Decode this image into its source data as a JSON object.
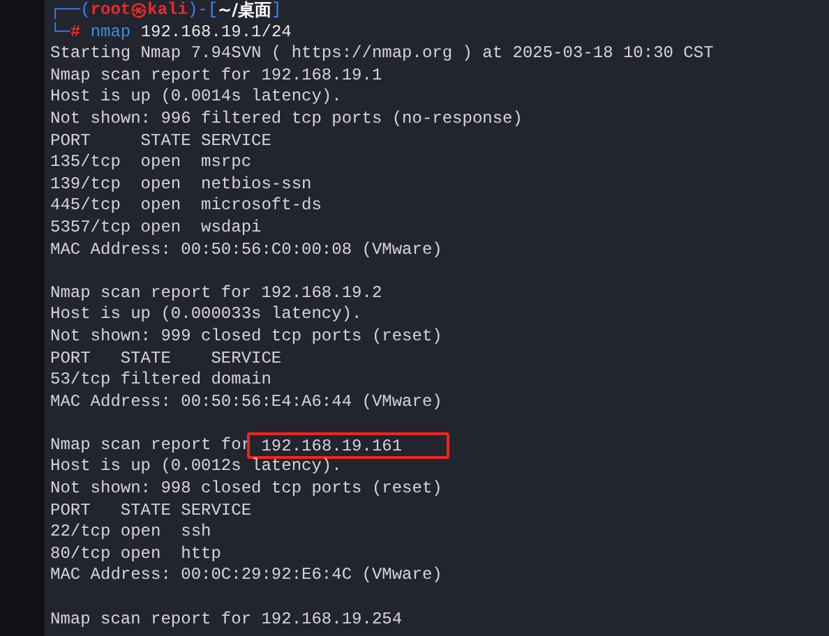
{
  "prompt": {
    "corner_top": "┌──(",
    "user": "root",
    "at": "㉿",
    "host": "kali",
    "mid": ")-[",
    "path": "~/桌面",
    "close": "]",
    "corner_bottom": "└─",
    "marker": "#",
    "command": "nmap",
    "args": "192.168.19.1/24"
  },
  "lines": [
    {
      "kind": "text",
      "text": "Starting Nmap 7.94SVN ( https://nmap.org ) at 2025-03-18 10:30 CST"
    },
    {
      "kind": "text",
      "text": "Nmap scan report for 192.168.19.1"
    },
    {
      "kind": "text",
      "text": "Host is up (0.0014s latency)."
    },
    {
      "kind": "text",
      "text": "Not shown: 996 filtered tcp ports (no-response)"
    },
    {
      "kind": "text",
      "text": "PORT     STATE SERVICE"
    },
    {
      "kind": "text",
      "text": "135/tcp  open  msrpc"
    },
    {
      "kind": "text",
      "text": "139/tcp  open  netbios-ssn"
    },
    {
      "kind": "text",
      "text": "445/tcp  open  microsoft-ds"
    },
    {
      "kind": "text",
      "text": "5357/tcp open  wsdapi"
    },
    {
      "kind": "text",
      "text": "MAC Address: 00:50:56:C0:00:08 (VMware)"
    },
    {
      "kind": "blank"
    },
    {
      "kind": "text",
      "text": "Nmap scan report for 192.168.19.2"
    },
    {
      "kind": "text",
      "text": "Host is up (0.000033s latency)."
    },
    {
      "kind": "text",
      "text": "Not shown: 999 closed tcp ports (reset)"
    },
    {
      "kind": "text",
      "text": "PORT   STATE    SERVICE"
    },
    {
      "kind": "text",
      "text": "53/tcp filtered domain"
    },
    {
      "kind": "text",
      "text": "MAC Address: 00:50:56:E4:A6:44 (VMware)"
    },
    {
      "kind": "blank"
    },
    {
      "kind": "text",
      "text": "Nmap scan report for ",
      "boxed": "192.168.19.161"
    },
    {
      "kind": "text",
      "text": "Host is up (0.0012s latency)."
    },
    {
      "kind": "text",
      "text": "Not shown: 998 closed tcp ports (reset)"
    },
    {
      "kind": "text",
      "text": "PORT   STATE SERVICE"
    },
    {
      "kind": "text",
      "text": "22/tcp open  ssh"
    },
    {
      "kind": "text",
      "text": "80/tcp open  http"
    },
    {
      "kind": "text",
      "text": "MAC Address: 00:0C:29:92:E6:4C (VMware)"
    },
    {
      "kind": "blank"
    },
    {
      "kind": "text",
      "text": "Nmap scan report for 192.168.19.254"
    }
  ]
}
